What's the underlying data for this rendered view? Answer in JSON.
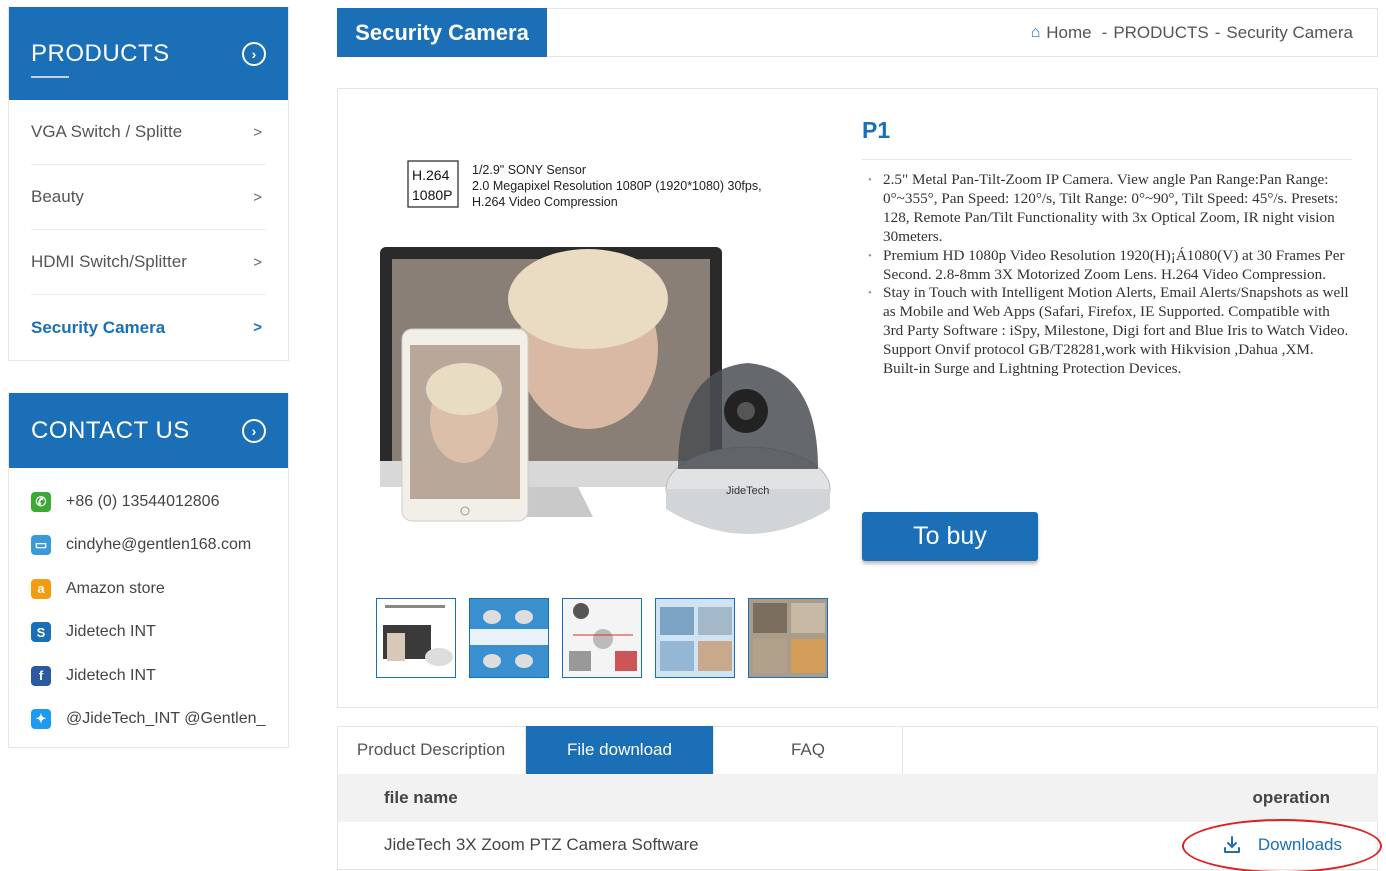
{
  "sidebar": {
    "products_title": "PRODUCTS",
    "products": [
      {
        "label": "VGA Switch / Splitte",
        "arrow": ">"
      },
      {
        "label": "Beauty",
        "arrow": ">"
      },
      {
        "label": "HDMI Switch/Splitter",
        "arrow": ">"
      },
      {
        "label": "Security Camera",
        "arrow": ">"
      }
    ],
    "contact_title": "CONTACT US",
    "contacts": [
      {
        "icon": "phone-icon",
        "color": "#3aaa35",
        "glyph": "✆",
        "text": "+86 (0) 13544012806"
      },
      {
        "icon": "email-icon",
        "color": "#3a9ad9",
        "glyph": "▭",
        "text": "cindyhe@gentlen168.com"
      },
      {
        "icon": "amazon-icon",
        "color": "#f39c12",
        "glyph": "a",
        "text": "Amazon store"
      },
      {
        "icon": "skype-icon",
        "color": "#1a6fb6",
        "glyph": "S",
        "text": "Jidetech INT"
      },
      {
        "icon": "facebook-icon",
        "color": "#2c5aa0",
        "glyph": "f",
        "text": "Jidetech INT"
      },
      {
        "icon": "twitter-icon",
        "color": "#1d9bf0",
        "glyph": "✦",
        "text": "@JideTech_INT @Gentlen_("
      }
    ]
  },
  "header": {
    "category_tag": "Security Camera",
    "breadcrumb": {
      "home": "Home",
      "sep": "-",
      "level1": "PRODUCTS",
      "level2": "Security Camera"
    }
  },
  "product": {
    "name": "P1",
    "image_caption": {
      "badge_line1": "H.264",
      "badge_line2": "1080P",
      "spec1": "1/2.9\" SONY Sensor",
      "spec2": "2.0 Megapixel Resolution 1080P (1920*1080) 30fps,",
      "spec3": "H.264 Video Compression",
      "camera_brand": "JideTech"
    },
    "bullets": [
      "2.5\" Metal Pan-Tilt-Zoom IP Camera. View angle Pan Range:Pan Range: 0°~355°, Pan Speed: 120°/s, Tilt Range: 0°~90°, Tilt Speed: 45°/s. Presets: 128, Remote Pan/Tilt Functionality with 3x Optical Zoom, IR night vision 30meters.",
      "Premium HD 1080p Video Resolution 1920(H)¡Á1080(V) at 30 Frames Per Second. 2.8-8mm 3X Motorized Zoom Lens. H.264 Video Compression.",
      "Stay in Touch with Intelligent Motion Alerts, Email Alerts/Snapshots as well as Mobile and Web Apps (Safari, Firefox, IE Supported. Compatible with 3rd Party Software : iSpy, Milestone, Digi fort and Blue Iris to Watch Video. Support Onvif protocol GB/T28281,work with Hikvision ,Dahua ,XM. Built-in Surge and Lightning Protection Devices."
    ],
    "buy_label": "To buy"
  },
  "tabs": [
    {
      "label": "Product Description"
    },
    {
      "label": "File download"
    },
    {
      "label": "FAQ"
    }
  ],
  "downloads": {
    "col_file": "file name",
    "col_op": "operation",
    "rows": [
      {
        "file": "JideTech 3X Zoom PTZ Camera Software",
        "action": "Downloads"
      }
    ]
  },
  "colors": {
    "accent": "#1a6fb6",
    "highlight": "#e02020"
  }
}
